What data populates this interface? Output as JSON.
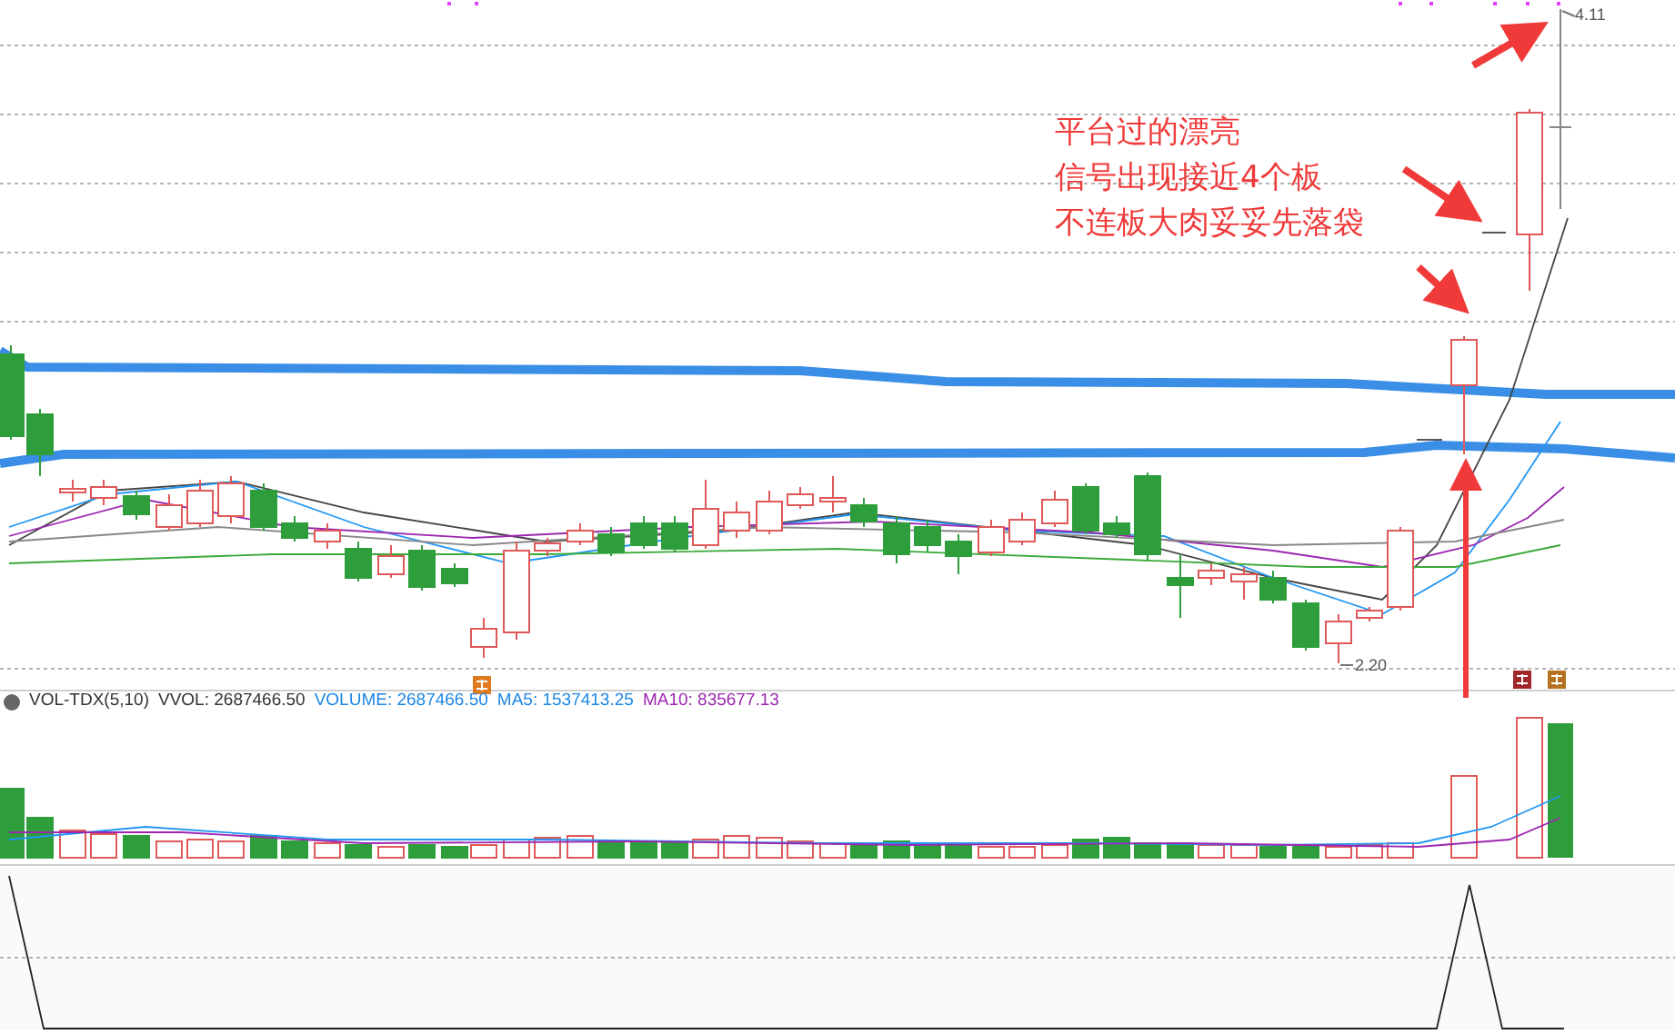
{
  "annotation": {
    "lines": [
      "平台过的漂亮",
      "信号出现接近4个板",
      "不连板大肉妥妥先落袋"
    ]
  },
  "price_labels": {
    "high": "4.11",
    "low": "2.20"
  },
  "indicator": {
    "items": [
      {
        "text": "VOL-TDX(5,10)",
        "color": "#333333"
      },
      {
        "text": "VVOL: 2687466.50",
        "color": "#333333"
      },
      {
        "text": "VOLUME: 2687466.50",
        "color": "#1e88e5"
      },
      {
        "text": "MA5: 1537413.25",
        "color": "#1e88e5"
      },
      {
        "text": "MA10: 835677.13",
        "color": "#9c27b0"
      }
    ]
  }
}
